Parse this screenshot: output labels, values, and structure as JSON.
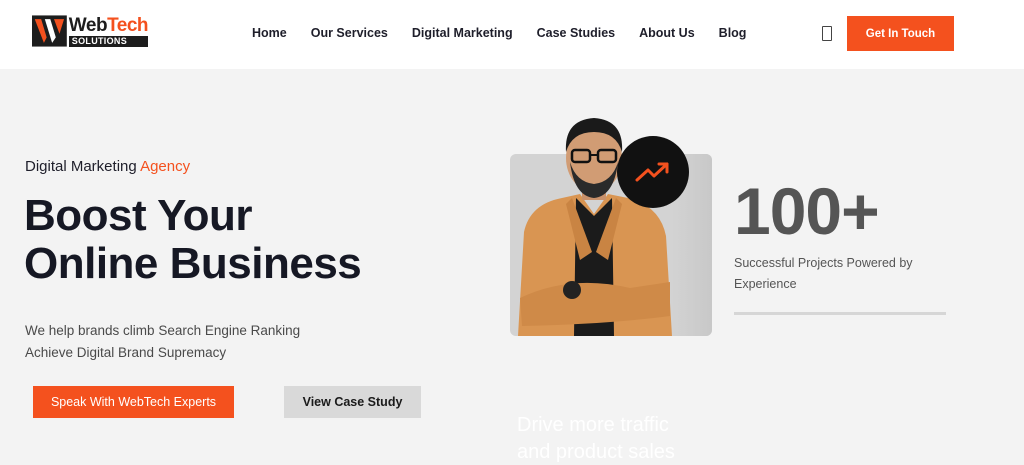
{
  "brand": {
    "name_part1": "Web",
    "name_part2": "Tech",
    "sub": "SOLUTIONS"
  },
  "nav": {
    "items": [
      "Home",
      "Our Services",
      "Digital Marketing",
      "Case Studies",
      "About Us",
      "Blog"
    ]
  },
  "header": {
    "cta_label": "Get In Touch",
    "cart_icon": "cart-icon"
  },
  "hero": {
    "eyebrow_prefix": "Digital Marketing",
    "eyebrow_accent": "Agency",
    "title_line1": "Boost Your",
    "title_line2": "Online Business",
    "desc_line1": "We help brands climb Search Engine Ranking",
    "desc_line2": "Achieve Digital Brand Supremacy",
    "primary_button": "Speak With WebTech Experts",
    "secondary_button": "View Case Study"
  },
  "stats": {
    "number": "100+",
    "caption_line1": "Successful Projects Powered by",
    "caption_line2": "Experience"
  },
  "promo": {
    "line1": "Drive more traffic",
    "line2": "and product sales"
  },
  "colors": {
    "accent": "#f4511e",
    "dark": "#161824",
    "background": "#f3f3f3"
  }
}
